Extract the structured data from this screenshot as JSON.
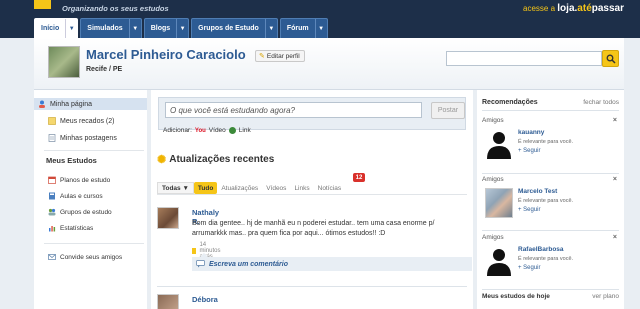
{
  "header": {
    "tagline": "Organizando os seus estudos",
    "store_prefix": "acesse a",
    "store_name_a": "loja.",
    "store_name_b": "até",
    "store_name_c": "passar",
    "tabs": [
      {
        "label": "Início",
        "active": true
      },
      {
        "label": "Simulados",
        "active": false
      },
      {
        "label": "Blogs",
        "active": false
      },
      {
        "label": "Grupos de Estudo",
        "active": false
      },
      {
        "label": "Fórum",
        "active": false
      }
    ]
  },
  "profile": {
    "name": "Marcel Pinheiro Caraciolo",
    "location": "Recife / PE",
    "edit_label": "Editar perfil",
    "search_value": ""
  },
  "sidebar": {
    "items": [
      {
        "label": "Minha página",
        "icon": "user-icon",
        "selected": true
      },
      {
        "label": "Meus recados (2)",
        "icon": "note-icon",
        "selected": false
      },
      {
        "label": "Minhas postagens",
        "icon": "document-icon",
        "selected": false
      }
    ],
    "section_title": "Meus Estudos",
    "study_items": [
      {
        "label": "Planos de estudo",
        "icon": "calendar-icon"
      },
      {
        "label": "Aulas e cursos",
        "icon": "book-icon"
      },
      {
        "label": "Grupos de estudo",
        "icon": "group-icon"
      },
      {
        "label": "Estatísticas",
        "icon": "chart-icon"
      }
    ],
    "invite_label": "Convide seus amigos"
  },
  "composer": {
    "placeholder": "O que você está estudando agora?",
    "post_label": "Postar",
    "add_label": "Adicionar:",
    "video_label": "Vídeo",
    "link_label": "Link"
  },
  "updates": {
    "title": "Atualizações recentes",
    "filters": [
      "Todas",
      "Tudo",
      "Atualizações",
      "Vídeos",
      "Links",
      "Notícias"
    ],
    "news_count": "12",
    "posts": [
      {
        "author": "Nathaly R.",
        "text": "Bom dia gentee.. hj de manhã eu n poderei estudar.. tem uma casa enorme p/ arrumarkkk mas.. pra quem fica por aqui... ótimos estudos!! :D",
        "time": "14 minutos atrás",
        "comment_label": "Escreva um comentário"
      },
      {
        "author": "Débora"
      }
    ]
  },
  "recommendations": {
    "title": "Recomendações",
    "close_label": "fechar todos",
    "friends": [
      {
        "type": "Amigos",
        "name": "kauanny",
        "desc": "É relevante para você.",
        "follow": "+ Seguir",
        "photo": false
      },
      {
        "type": "Amigos",
        "name": "Marcelo Test",
        "desc": "É relevante para você.",
        "follow": "+ Seguir",
        "photo": true
      },
      {
        "type": "Amigos",
        "name": "RafaelBarbosa",
        "desc": "É relevante para você.",
        "follow": "+ Seguir",
        "photo": false
      }
    ],
    "footer_title": "Meus estudos de hoje",
    "footer_action": "ver plano"
  }
}
